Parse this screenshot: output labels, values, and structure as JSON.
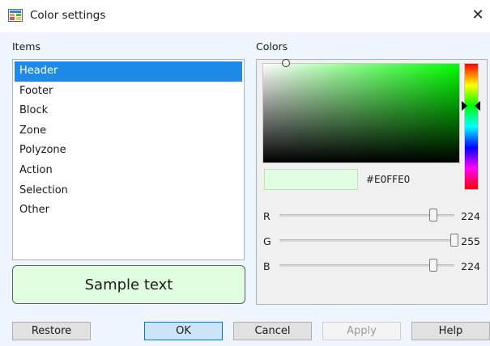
{
  "window": {
    "title": "Color settings",
    "close_glyph": "✕"
  },
  "items": {
    "label": "Items",
    "list": [
      {
        "label": "Header",
        "selected": true
      },
      {
        "label": "Footer",
        "selected": false
      },
      {
        "label": "Block",
        "selected": false
      },
      {
        "label": "Zone",
        "selected": false
      },
      {
        "label": "Polyzone",
        "selected": false
      },
      {
        "label": "Action",
        "selected": false
      },
      {
        "label": "Selection",
        "selected": false
      },
      {
        "label": "Other",
        "selected": false
      }
    ]
  },
  "sample": {
    "text": "Sample text",
    "background": "#E0FFE0"
  },
  "colors": {
    "label": "Colors",
    "hex": "#E0FFE0",
    "swatch_color": "#E0FFE0",
    "hue_color": "#00FF00",
    "sliders": {
      "r": {
        "label": "R",
        "value": 224,
        "max": 255
      },
      "g": {
        "label": "G",
        "value": 255,
        "max": 255
      },
      "b": {
        "label": "B",
        "value": 224,
        "max": 255
      }
    }
  },
  "buttons": {
    "restore": "Restore",
    "ok": "OK",
    "cancel": "Cancel",
    "apply": "Apply",
    "help": "Help"
  },
  "icons": {
    "app": "color-palette-icon",
    "close": "close-icon"
  }
}
